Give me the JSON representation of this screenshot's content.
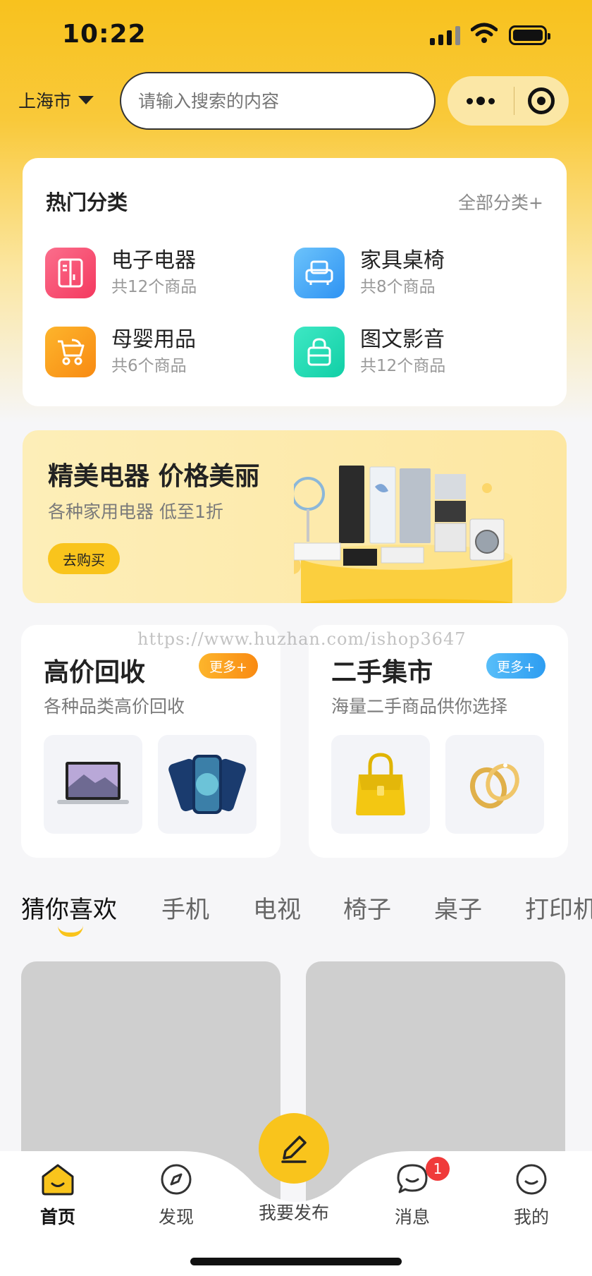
{
  "status": {
    "time": "10:22"
  },
  "header": {
    "city": "上海市",
    "search_placeholder": "请输入搜索的内容"
  },
  "hot": {
    "title": "热门分类",
    "all_label": "全部分类+",
    "categories": [
      {
        "name": "电子电器",
        "count": "共12个商品",
        "icon": "fridge-icon",
        "color": "#f7517a"
      },
      {
        "name": "家具桌椅",
        "count": "共8个商品",
        "icon": "sofa-icon",
        "color": "#3aa6f7"
      },
      {
        "name": "母婴用品",
        "count": "共6个商品",
        "icon": "stroller-icon",
        "color": "#fb9a1a"
      },
      {
        "name": "图文影音",
        "count": "共12个商品",
        "icon": "bag-icon",
        "color": "#1cd9b2"
      }
    ]
  },
  "banner": {
    "title": "精美电器 价格美丽",
    "subtitle": "各种家用电器 低至1折",
    "button": "去购买"
  },
  "recycle": {
    "title": "高价回收",
    "more": "更多+",
    "subtitle": "各种品类高价回收"
  },
  "market": {
    "title": "二手集市",
    "more": "更多+",
    "subtitle": "海量二手商品供你选择"
  },
  "watermark": "https://www.huzhan.com/ishop3647",
  "tabs": [
    "猜你喜欢",
    "手机",
    "电视",
    "椅子",
    "桌子",
    "打印机"
  ],
  "tabbar": {
    "home": "首页",
    "discover": "发现",
    "publish": "我要发布",
    "messages": "消息",
    "messages_badge": "1",
    "mine": "我的"
  },
  "colors": {
    "accent": "#f9c41c",
    "recycle_more": "#fb9a1a",
    "market_more": "#36a8f5"
  }
}
